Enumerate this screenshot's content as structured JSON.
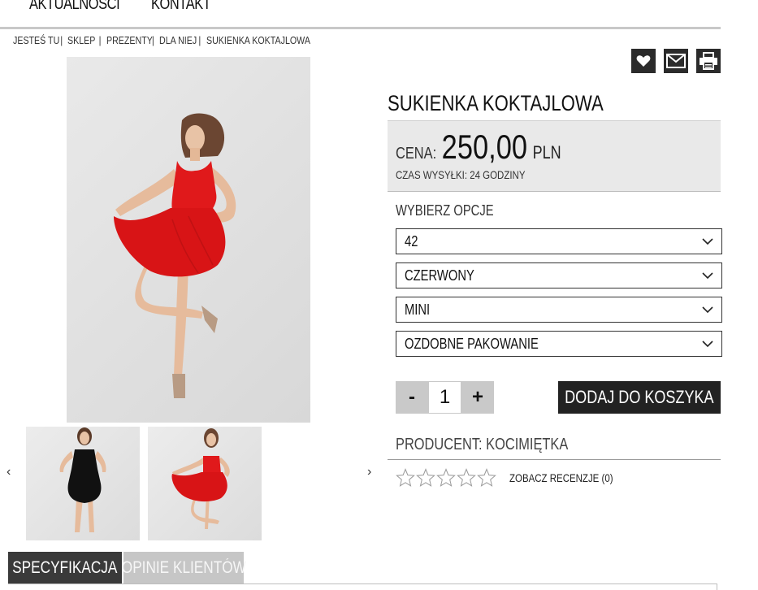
{
  "nav": {
    "items": [
      {
        "label": "AKTUALNOŚCI"
      },
      {
        "label": "KONTAKT"
      }
    ]
  },
  "breadcrumb": {
    "items": [
      "JESTEŚ TU",
      "SKLEP",
      "PREZENTY",
      "DLA NIEJ",
      "SUKIENKA KOKTAJLOWA"
    ],
    "separator": "|"
  },
  "product": {
    "title": "SUKIENKA KOKTAJLOWA",
    "price_label": "CENA:",
    "price_value": "250,00",
    "currency": "PLN",
    "shipping": "CZAS WYSYŁKI: 24 GODZINY",
    "options_label": "WYBIERZ OPCJE",
    "options": [
      {
        "selected": "42"
      },
      {
        "selected": "CZERWONY"
      },
      {
        "selected": "MINI"
      },
      {
        "selected": "OZDOBNE PAKOWANIE"
      }
    ],
    "qty": {
      "minus": "-",
      "value": "1",
      "plus": "+"
    },
    "add_to_cart": "DODAJ DO KOSZYKA",
    "producer": "PRODUCENT: KOCIMIĘTKA",
    "rating": 0,
    "rating_max": 5,
    "reviews_link": "ZOBACZ RECENZJE (0)"
  },
  "gallery": {
    "prev": "‹",
    "next": "›",
    "thumbs": [
      {
        "dress_color": "#111111"
      },
      {
        "dress_color": "#e0191b"
      }
    ],
    "main_dress_color": "#e0191b"
  },
  "tabs": [
    {
      "label": "SPECYFIKACJA"
    },
    {
      "label": "OPINIE KLIENTÓW"
    }
  ],
  "icons": [
    "heart-icon",
    "mail-icon",
    "print-icon"
  ]
}
